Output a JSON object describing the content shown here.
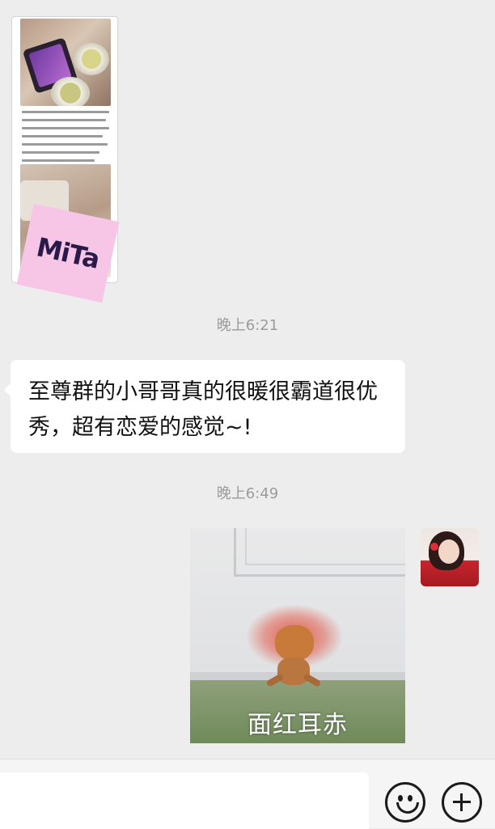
{
  "messages": {
    "received_image": {
      "logo_text": "MiTa"
    },
    "timestamp_1": "晚上6:21",
    "received_text": "至尊群的小哥哥真的很暖很霸道很优秀，超有恋爱的感觉~!",
    "timestamp_2": "晚上6:49",
    "sent_sticker": {
      "caption": "面红耳赤"
    }
  },
  "input_bar": {
    "input_value": "",
    "emoji_icon": "emoji-icon",
    "plus_icon": "plus-icon"
  }
}
